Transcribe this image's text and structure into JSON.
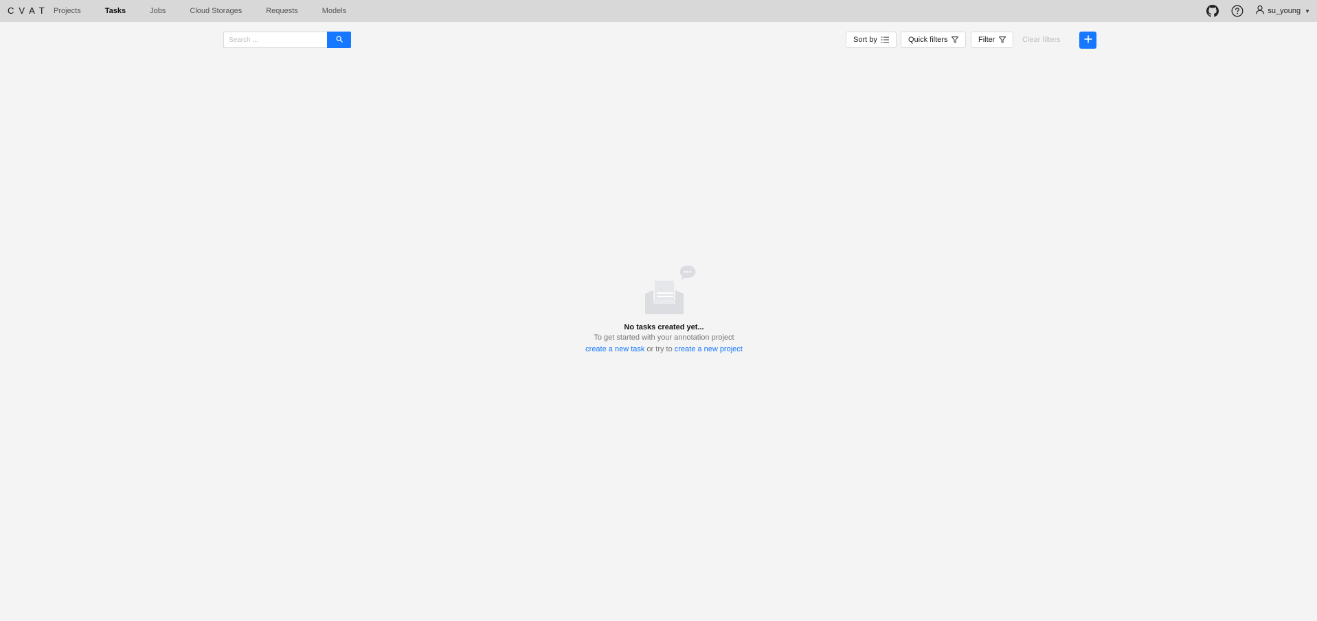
{
  "header": {
    "logo": "CVAT",
    "nav": [
      {
        "label": "Projects",
        "active": false
      },
      {
        "label": "Tasks",
        "active": true
      },
      {
        "label": "Jobs",
        "active": false
      },
      {
        "label": "Cloud Storages",
        "active": false
      },
      {
        "label": "Requests",
        "active": false
      },
      {
        "label": "Models",
        "active": false
      }
    ],
    "icons": [
      "github-icon",
      "help-icon",
      "user-icon"
    ],
    "user": {
      "name": "su_young"
    }
  },
  "toolbar": {
    "search_placeholder": "Search ...",
    "sort_label": "Sort by",
    "quick_filters_label": "Quick filters",
    "filter_label": "Filter",
    "clear_filters_label": "Clear filters"
  },
  "empty_state": {
    "title": "No tasks created yet...",
    "subtitle": "To get started with your annotation project",
    "link_task": "create a new task",
    "connector": " or try to ",
    "link_project": "create a new project"
  },
  "colors": {
    "accent": "#1677ff",
    "header_bg": "#d8d8d8",
    "page_bg": "#f4f4f4"
  }
}
